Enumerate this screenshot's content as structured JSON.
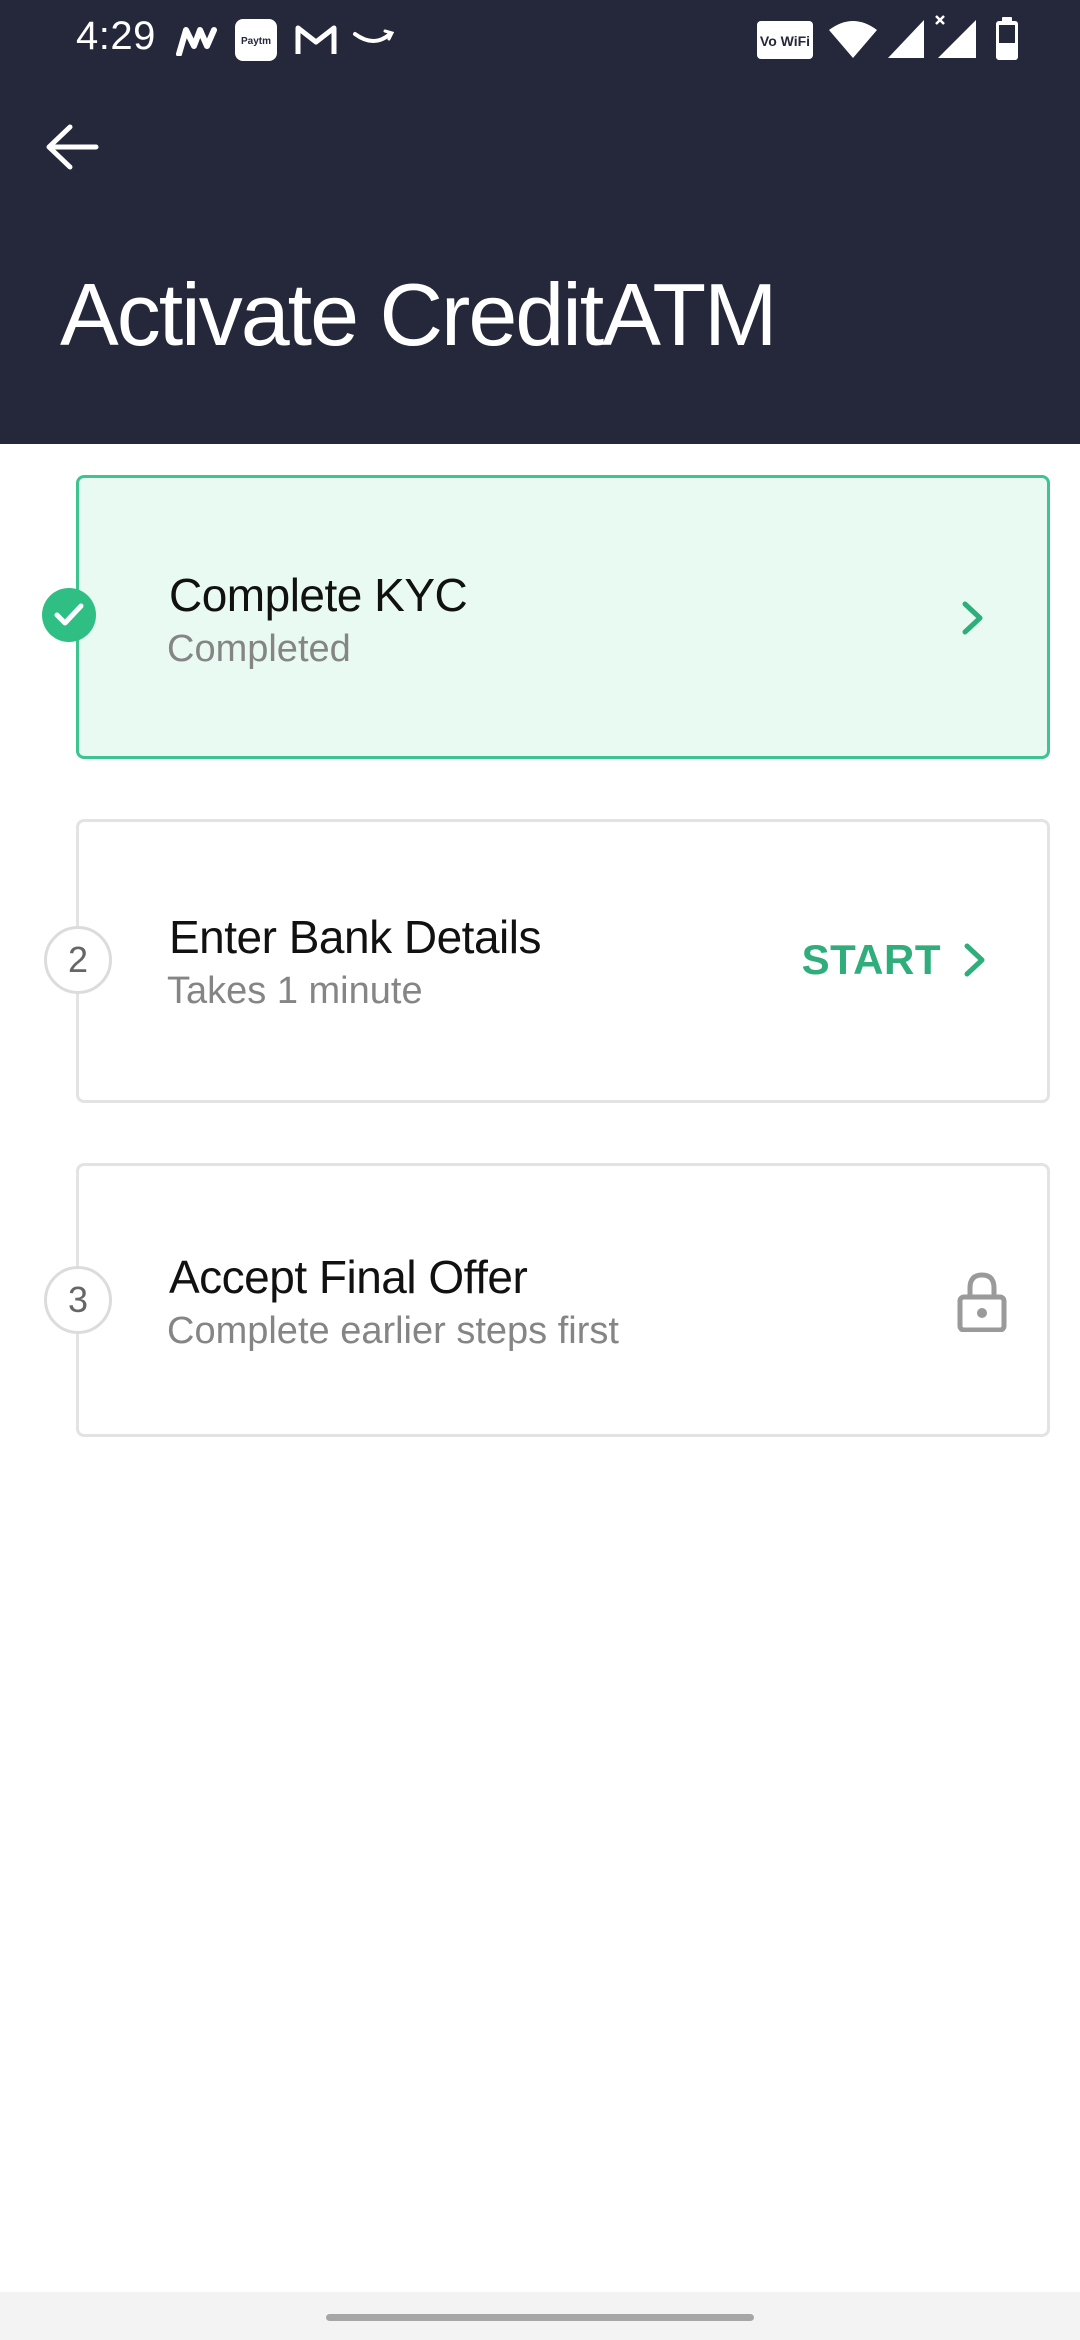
{
  "status_bar": {
    "time": "4:29",
    "left_icons": [
      "myntra-icon",
      "paytm-icon",
      "gmail-icon",
      "amazon-icon"
    ],
    "right_icons": [
      "vowifi-icon",
      "wifi-icon",
      "signal-icon",
      "signal-x-icon",
      "battery-icon"
    ],
    "paytm_text": "Paytm",
    "vowifi_text": "Vo WiFi"
  },
  "header": {
    "title": "Activate CreditATM",
    "background": "#25273b",
    "back_icon": "back-arrow-icon"
  },
  "steps": [
    {
      "marker": "check-icon",
      "title": "Complete KYC",
      "subtitle": "Completed",
      "state": "completed",
      "action_icon": "chevron-right-icon"
    },
    {
      "marker": "2",
      "title": "Enter Bank Details",
      "subtitle": "Takes 1 minute",
      "state": "current",
      "action_label": "START",
      "action_icon": "chevron-right-icon"
    },
    {
      "marker": "3",
      "title": "Accept Final Offer",
      "subtitle": "Complete earlier steps first",
      "state": "locked",
      "action_icon": "lock-icon"
    }
  ],
  "colors": {
    "accent_green": "#2fae7c",
    "completed_bg": "#e8faf2",
    "completed_border": "#3dc490",
    "header_bg": "#25273b"
  }
}
